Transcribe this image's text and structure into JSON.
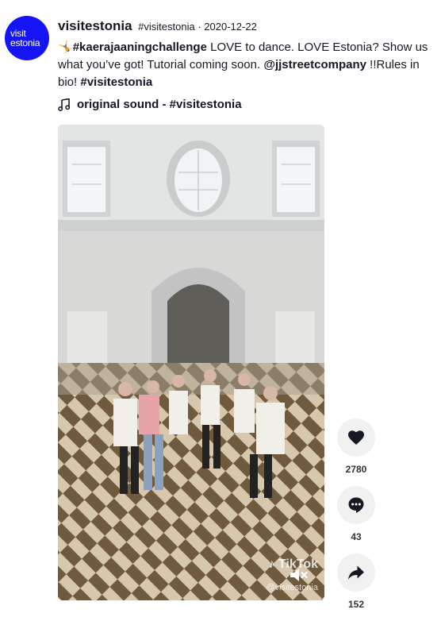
{
  "author": {
    "avatar_line1": "visit",
    "avatar_line2": "estonia",
    "username": "visitestonia",
    "nickname": "#visitestonia",
    "separator": "·",
    "date": "2020-12-22"
  },
  "description": {
    "emoji": "🤸",
    "challenge_tag": "#kaerajaaningchallenge",
    "text1": " LOVE to dance. LOVE Estonia? Show us what you’ve got! Tutorial coming soon. ",
    "mention": "@jjstreetcompany",
    "text2": " !!Rules in bio! ",
    "tag2": "#visitestonia"
  },
  "music": {
    "icon": "music-note-icon",
    "title": "original sound - #visitestonia"
  },
  "video": {
    "watermark_brand": "TikTok",
    "watermark_handle": "@visitestonia",
    "mute_icon": "muted-speaker-icon"
  },
  "actions": {
    "likes": "2780",
    "comments": "43",
    "shares": "152"
  },
  "colors": {
    "brand_blue": "#1414f5",
    "text": "#161823",
    "button_bg": "#f1f1f2"
  }
}
